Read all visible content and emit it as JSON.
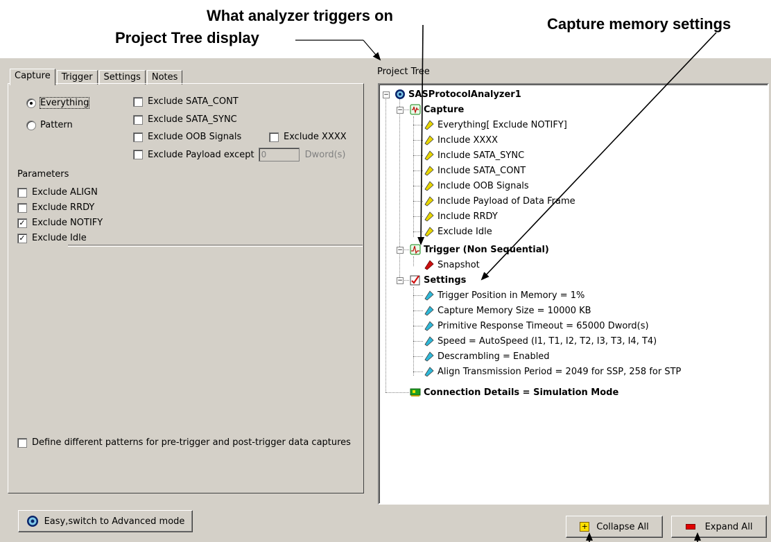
{
  "callouts": {
    "triggers": "What analyzer triggers on",
    "tree_display": "Project Tree display",
    "capture_memory": "Capture memory settings"
  },
  "tabs": [
    "Capture",
    "Trigger",
    "Settings",
    "Notes"
  ],
  "capture": {
    "modes": {
      "everything": "Everything",
      "pattern": "Pattern",
      "selected": "Everything"
    },
    "excludes": {
      "sata_cont": "Exclude SATA_CONT",
      "sata_sync": "Exclude SATA_SYNC",
      "oob": "Exclude OOB Signals",
      "xxxx": "Exclude XXXX",
      "payload": "Exclude Payload except",
      "payload_value": "0",
      "payload_unit": "Dword(s)"
    },
    "parameters_label": "Parameters",
    "parameters": [
      {
        "label": "Exclude ALIGN",
        "checked": false
      },
      {
        "label": "Exclude RRDY",
        "checked": false
      },
      {
        "label": "Exclude NOTIFY",
        "checked": true
      },
      {
        "label": "Exclude Idle",
        "checked": true
      }
    ],
    "define_patterns": "Define different patterns for pre-trigger and post-trigger data captures"
  },
  "project_tree": {
    "label": "Project Tree",
    "root": "SASProtocolAnalyzer1",
    "capture": {
      "label": "Capture",
      "items": [
        "Everything[ Exclude NOTIFY]",
        "Include XXXX",
        "Include SATA_SYNC",
        "Include SATA_CONT",
        "Include OOB Signals",
        "Include Payload of Data Frame",
        "Include RRDY",
        "Exclude Idle"
      ]
    },
    "trigger": {
      "label": "Trigger (Non Sequential)",
      "items": [
        "Snapshot"
      ]
    },
    "settings": {
      "label": "Settings",
      "items": [
        "Trigger Position in Memory = 1%",
        "Capture Memory Size = 10000 KB",
        "Primitive Response Timeout = 65000 Dword(s)",
        "Speed = AutoSpeed (I1, T1, I2, T2, I3, T3, I4, T4)",
        "Descrambling = Enabled",
        "Align Transmission Period = 2049 for SSP, 258 for STP"
      ]
    },
    "connection": "Connection Details = Simulation Mode"
  },
  "buttons": {
    "mode": "Easy,switch to Advanced mode",
    "collapse": "Collapse All",
    "expand": "Expand All"
  },
  "colors": {
    "window": "#d4d0c8",
    "capture_item": "#e8d600",
    "settings_item": "#2fb8d8",
    "trigger_item": "#cc1010"
  }
}
